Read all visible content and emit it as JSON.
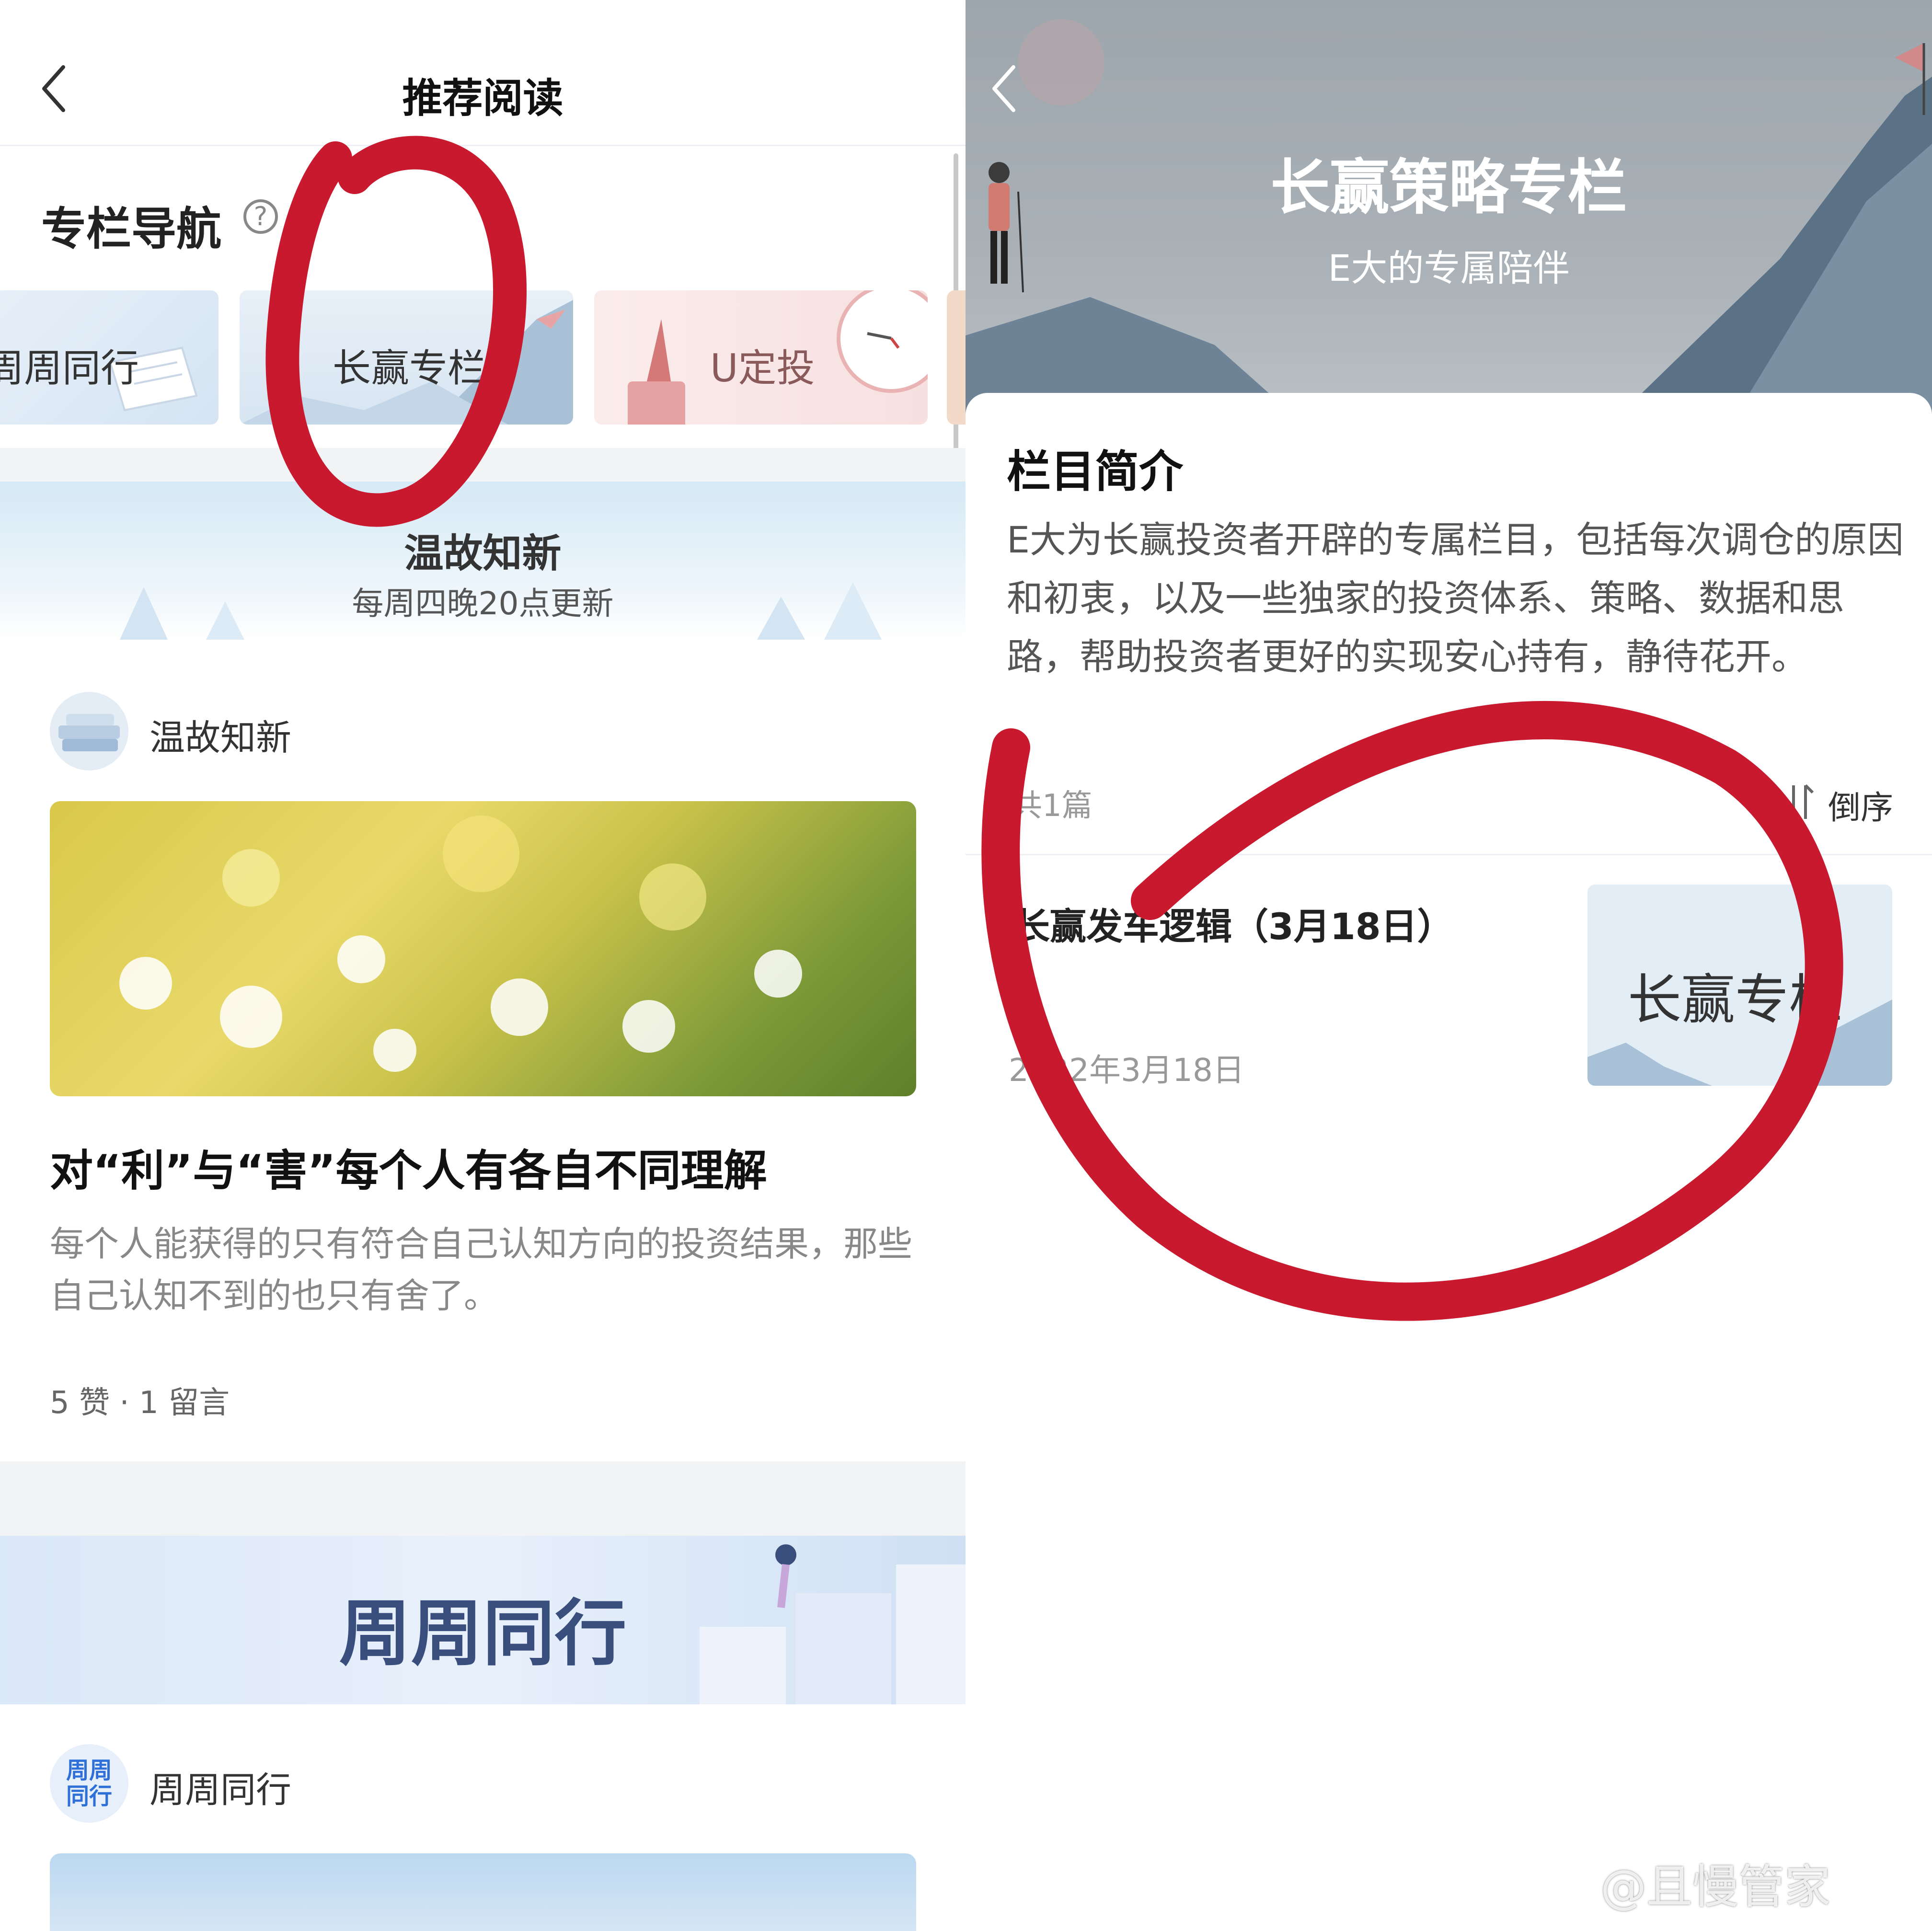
{
  "left": {
    "header": {
      "title": "推荐阅读"
    },
    "nav_section": {
      "title": "专栏导航",
      "help_glyph": "?"
    },
    "columns": [
      {
        "label": "周周同行"
      },
      {
        "label": "长赢专栏"
      },
      {
        "label": "U定投"
      }
    ],
    "banner": {
      "title": "温故知新",
      "subtitle": "每周四晚20点更新"
    },
    "post": {
      "author": "温故知新",
      "title": "对“利”与“害”每个人有各自不同理解",
      "desc": "每个人能获得的只有符合自己认知方向的投资结果，那些自己认知不到的也只有舍了。",
      "meta": "5 赞 · 1 留言"
    },
    "banner2": {
      "title": "周周同行"
    },
    "post2": {
      "author": "周周同行",
      "avatar_text": "周周\n同行"
    }
  },
  "right": {
    "hero": {
      "title": "长赢策略专栏",
      "subtitle": "E大的专属陪伴"
    },
    "intro": {
      "title": "栏目简介",
      "text": "E大为长赢投资者开辟的专属栏目，包括每次调仓的原因和初衷，以及一些独家的投资体系、策略、数据和思路，帮助投资者更好的实现安心持有，静待花开。"
    },
    "list_header": {
      "count": "共1篇",
      "order": "倒序"
    },
    "items": [
      {
        "title": "长赢发车逻辑（3月18日）",
        "date": "2022年3月18日",
        "thumb_label": "长赢专栏"
      }
    ]
  },
  "watermark": "@且慢管家",
  "colors": {
    "annotation_red": "#c8192e",
    "tile_pink": "#fbe3e3",
    "tile_blue": "#e4eef8"
  },
  "icons": [
    "back-icon",
    "help-icon",
    "sort-icon",
    "weibo-logo-icon"
  ]
}
